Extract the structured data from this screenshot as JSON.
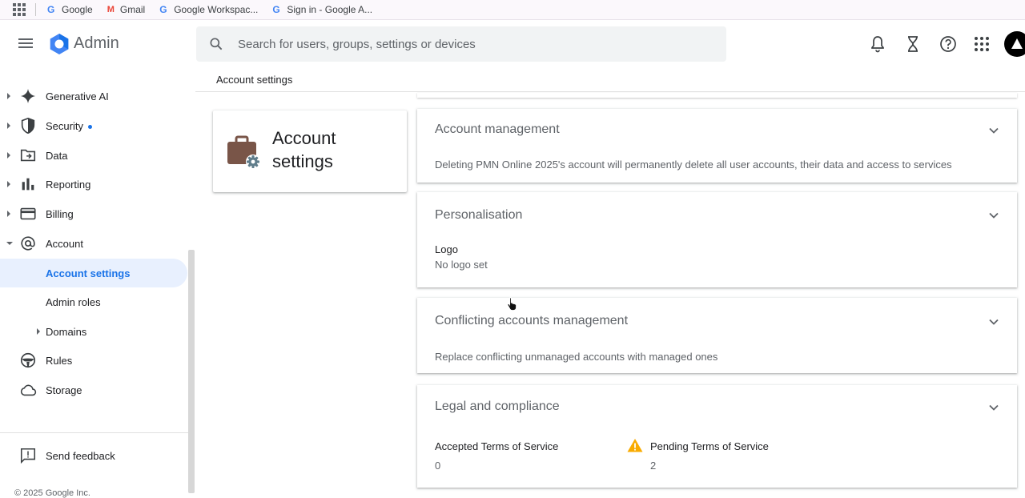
{
  "bookmarks": {
    "items": [
      {
        "label": "Google",
        "icon": "google-g-icon"
      },
      {
        "label": "Gmail",
        "icon": "gmail-icon"
      },
      {
        "label": "Google Workspac...",
        "icon": "google-g-icon"
      },
      {
        "label": "Sign in - Google A...",
        "icon": "google-g-icon"
      }
    ]
  },
  "header": {
    "brand": "Admin",
    "search_placeholder": "Search for users, groups, settings or devices"
  },
  "sidebar": {
    "items": [
      {
        "label": "Generative AI",
        "icon": "sparkle-icon"
      },
      {
        "label": "Security",
        "icon": "shield-icon"
      },
      {
        "label": "Data",
        "icon": "folder-data-icon"
      },
      {
        "label": "Reporting",
        "icon": "bar-chart-icon"
      },
      {
        "label": "Billing",
        "icon": "credit-card-icon"
      },
      {
        "label": "Account",
        "icon": "at-sign-icon"
      }
    ],
    "sub_items": [
      {
        "label": "Account settings",
        "active": true
      },
      {
        "label": "Admin roles"
      },
      {
        "label": "Domains"
      }
    ],
    "more_items": [
      {
        "label": "Rules",
        "icon": "steering-icon"
      },
      {
        "label": "Storage",
        "icon": "cloud-icon"
      }
    ],
    "feedback": "Send feedback",
    "copyright": "© 2025 Google Inc."
  },
  "breadcrumb": "Account settings",
  "title_card": {
    "title": "Account settings"
  },
  "cards": {
    "account_management": {
      "title": "Account management",
      "description": "Deleting PMN Online 2025's account will permanently delete all user accounts, their data and access to services"
    },
    "personalisation": {
      "title": "Personalisation",
      "logo_label": "Logo",
      "logo_value": "No logo set"
    },
    "conflicting": {
      "title": "Conflicting accounts management",
      "description": "Replace conflicting unmanaged accounts with managed ones"
    },
    "legal": {
      "title": "Legal and compliance",
      "accepted_label": "Accepted Terms of Service",
      "accepted_value": "0",
      "pending_label": "Pending Terms of Service",
      "pending_value": "2"
    }
  },
  "colors": {
    "accent": "#1a73e8",
    "active_bg": "#e8f0fe",
    "warning": "#f9ab00",
    "briefcase": "#795548"
  }
}
